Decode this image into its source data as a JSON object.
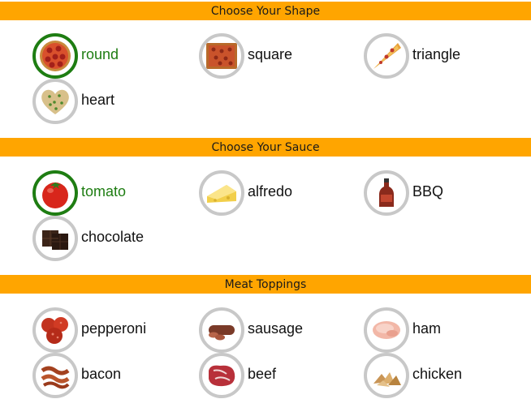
{
  "colors": {
    "band": "#FFA500",
    "selected": "#1e7d12",
    "unselected_ring": "#c8c8c8"
  },
  "sections": {
    "shape": {
      "title": "Choose Your Shape",
      "options": [
        {
          "label": "round",
          "icon": "round-pizza-icon",
          "selected": true
        },
        {
          "label": "square",
          "icon": "square-pizza-icon",
          "selected": false
        },
        {
          "label": "triangle",
          "icon": "pizza-slice-icon",
          "selected": false
        },
        {
          "label": "heart",
          "icon": "heart-pizza-icon",
          "selected": false
        }
      ]
    },
    "sauce": {
      "title": "Choose Your Sauce",
      "options": [
        {
          "label": "tomato",
          "icon": "tomato-icon",
          "selected": true
        },
        {
          "label": "alfredo",
          "icon": "cheese-icon",
          "selected": false
        },
        {
          "label": "BBQ",
          "icon": "bbq-bottle-icon",
          "selected": false
        },
        {
          "label": "chocolate",
          "icon": "chocolate-icon",
          "selected": false
        }
      ]
    },
    "meat": {
      "title": "Meat Toppings",
      "options": [
        {
          "label": "pepperoni",
          "icon": "pepperoni-icon",
          "selected": false
        },
        {
          "label": "sausage",
          "icon": "sausage-icon",
          "selected": false
        },
        {
          "label": "ham",
          "icon": "ham-icon",
          "selected": false
        },
        {
          "label": "bacon",
          "icon": "bacon-icon",
          "selected": false
        },
        {
          "label": "beef",
          "icon": "beef-icon",
          "selected": false
        },
        {
          "label": "chicken",
          "icon": "chicken-icon",
          "selected": false
        }
      ]
    }
  }
}
